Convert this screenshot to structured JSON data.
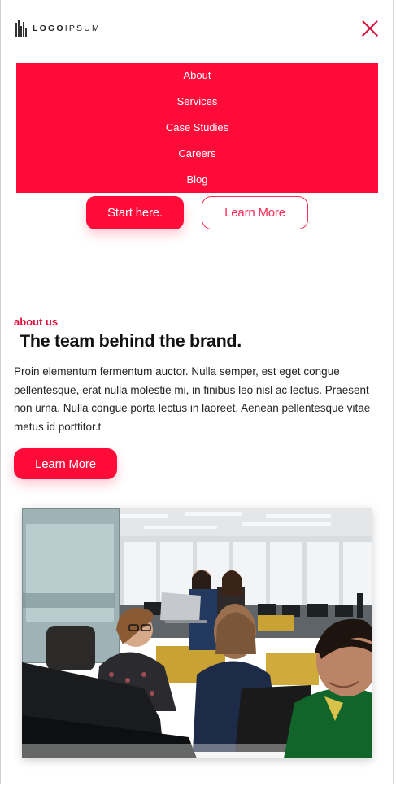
{
  "header": {
    "logo": {
      "text_bold": "LOGO",
      "text_light": "IPSUM"
    },
    "close_icon": "close-icon"
  },
  "nav": {
    "items": [
      {
        "label": "About"
      },
      {
        "label": "Services"
      },
      {
        "label": "Case Studies"
      },
      {
        "label": "Careers"
      },
      {
        "label": "Blog"
      }
    ]
  },
  "hero": {
    "primary_button": "Start here.",
    "secondary_button": "Learn More"
  },
  "about": {
    "eyebrow": "about us",
    "title": "The team behind the brand.",
    "body": "Proin elementum fermentum auctor. Nulla semper, est eget congue pellentesque, erat nulla molestie mi, in finibus leo nisl ac lectus. Praesent non urna. Nulla congue porta lectus in laoreet. Aenean pellentesque vitae metus id porttitor.t",
    "button": "Learn More"
  },
  "image": {
    "subject": "team-office-photo"
  },
  "colors": {
    "accent": "#ff0b3a",
    "accent_dark": "#d5103d",
    "text": "#111111",
    "background": "#ffffff"
  }
}
